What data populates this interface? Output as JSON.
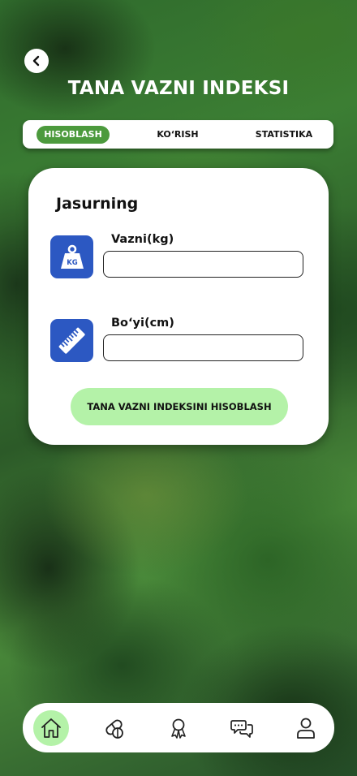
{
  "header": {
    "back_icon": "chevron-left-icon",
    "title": "TANA VAZNI INDEKSI"
  },
  "tabs": [
    {
      "label": "HISOBLASH",
      "active": true
    },
    {
      "label": "KO‘RISH",
      "active": false
    },
    {
      "label": "STATISTIKA",
      "active": false
    }
  ],
  "card": {
    "title": "Jasurning",
    "weight": {
      "label": "Vazni(kg)",
      "icon": "weight-kg-icon",
      "icon_text": "KG",
      "value": "",
      "placeholder": ""
    },
    "height": {
      "label": "Bo‘yi(cm)",
      "icon": "ruler-icon",
      "value": "",
      "placeholder": ""
    },
    "calculate_label": "TANA VAZNI INDEKSINI HISOBLASH"
  },
  "bottom_nav": {
    "items": [
      {
        "icon": "home-icon",
        "active": true
      },
      {
        "icon": "pill-icon",
        "active": false
      },
      {
        "icon": "award-ribbon-icon",
        "active": false
      },
      {
        "icon": "chat-icon",
        "active": false
      },
      {
        "icon": "user-icon",
        "active": false
      }
    ]
  },
  "colors": {
    "accent_green": "#4c9a3d",
    "button_green": "#b4f2a8",
    "icon_blue": "#2c58c2"
  }
}
